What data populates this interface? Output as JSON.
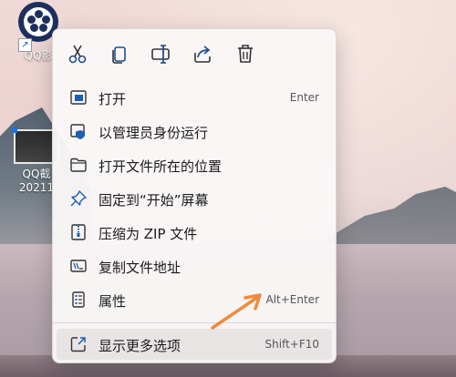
{
  "desktop": {
    "icons": [
      {
        "label": "QQ影"
      },
      {
        "label": "QQ截\n20211"
      }
    ]
  },
  "context_menu": {
    "toolbar": [
      {
        "icon": "cut-icon",
        "tooltip": ""
      },
      {
        "icon": "copy-icon",
        "tooltip": ""
      },
      {
        "icon": "rename-icon",
        "tooltip": ""
      },
      {
        "icon": "share-icon",
        "tooltip": ""
      },
      {
        "icon": "delete-icon",
        "tooltip": ""
      }
    ],
    "items": [
      {
        "label": "打开",
        "shortcut": "Enter",
        "icon": "open-app-icon"
      },
      {
        "label": "以管理员身份运行",
        "shortcut": "",
        "icon": "shield-icon"
      },
      {
        "label": "打开文件所在的位置",
        "shortcut": "",
        "icon": "folder-icon"
      },
      {
        "label": "固定到“开始”屏幕",
        "shortcut": "",
        "icon": "pin-icon"
      },
      {
        "label": "压缩为 ZIP 文件",
        "shortcut": "",
        "icon": "zip-icon"
      },
      {
        "label": "复制文件地址",
        "shortcut": "",
        "icon": "copy-path-icon"
      },
      {
        "label": "属性",
        "shortcut": "Alt+Enter",
        "icon": "properties-icon"
      },
      {
        "label": "显示更多选项",
        "shortcut": "Shift+F10",
        "icon": "more-options-icon"
      }
    ]
  },
  "colors": {
    "accent": "#1a5fb4",
    "annotation_arrow": "#f08a3c",
    "menu_background": "#faf7f7"
  }
}
